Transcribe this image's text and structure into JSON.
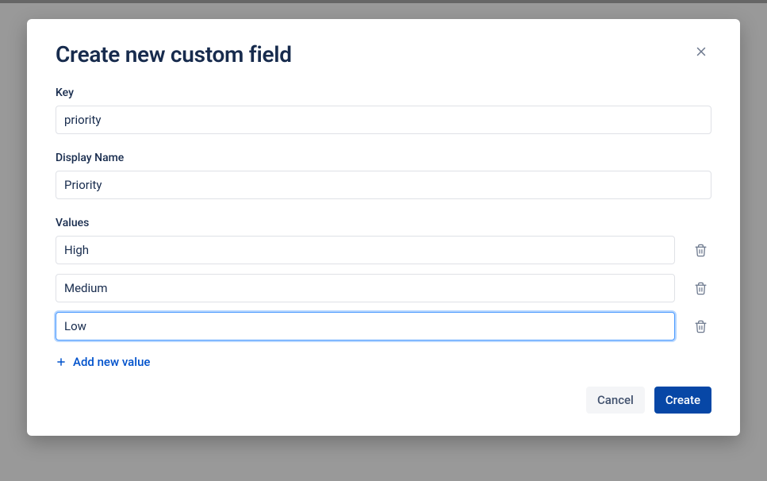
{
  "modal": {
    "title": "Create new custom field",
    "key": {
      "label": "Key",
      "value": "priority"
    },
    "displayName": {
      "label": "Display Name",
      "value": "Priority"
    },
    "values": {
      "label": "Values",
      "items": [
        {
          "value": "High",
          "focused": false
        },
        {
          "value": "Medium",
          "focused": false
        },
        {
          "value": "Low",
          "focused": true
        }
      ]
    },
    "addValueLabel": "Add new value",
    "actions": {
      "cancel": "Cancel",
      "create": "Create"
    }
  }
}
